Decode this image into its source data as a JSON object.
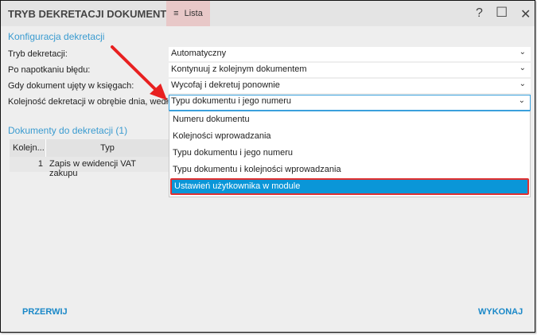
{
  "window": {
    "title": "TRYB DEKRETACJI DOKUMENTÓW",
    "menu_label": "Lista",
    "help": "?",
    "maximize": "☐",
    "close": "✕"
  },
  "config": {
    "section_title": "Konfiguracja dekretacji",
    "fields": [
      {
        "label": "Tryb dekretacji:",
        "value": "Automatyczny"
      },
      {
        "label": "Po napotkaniu błędu:",
        "value": "Kontynuuj z kolejnym dokumentem"
      },
      {
        "label": "Gdy dokument ujęty w księgach:",
        "value": "Wycofaj i dekretuj ponownie"
      },
      {
        "label": "Kolejność dekretacji w obrębie dnia, według:",
        "value": "Typu dokumentu i jego numeru"
      }
    ],
    "dropdown_options": [
      "Numeru dokumentu",
      "Kolejności wprowadzania",
      "Typu dokumentu i jego numeru",
      "Typu dokumentu i kolejności wprowadzania",
      "Ustawień użytkownika w module"
    ],
    "highlighted_option": "Ustawień użytkownika w module"
  },
  "documents": {
    "section_title": "Dokumenty do dekretacji (1)",
    "columns": [
      "Kolejn...",
      "Typ"
    ],
    "rows": [
      {
        "order": "1",
        "type": "Zapis w ewidencji VAT zakupu"
      }
    ]
  },
  "footer": {
    "cancel": "PRZERWIJ",
    "execute": "WYKONAJ"
  },
  "colors": {
    "accent": "#3a9bd0",
    "highlight": "#0a96d8",
    "annotation": "#e82020"
  }
}
